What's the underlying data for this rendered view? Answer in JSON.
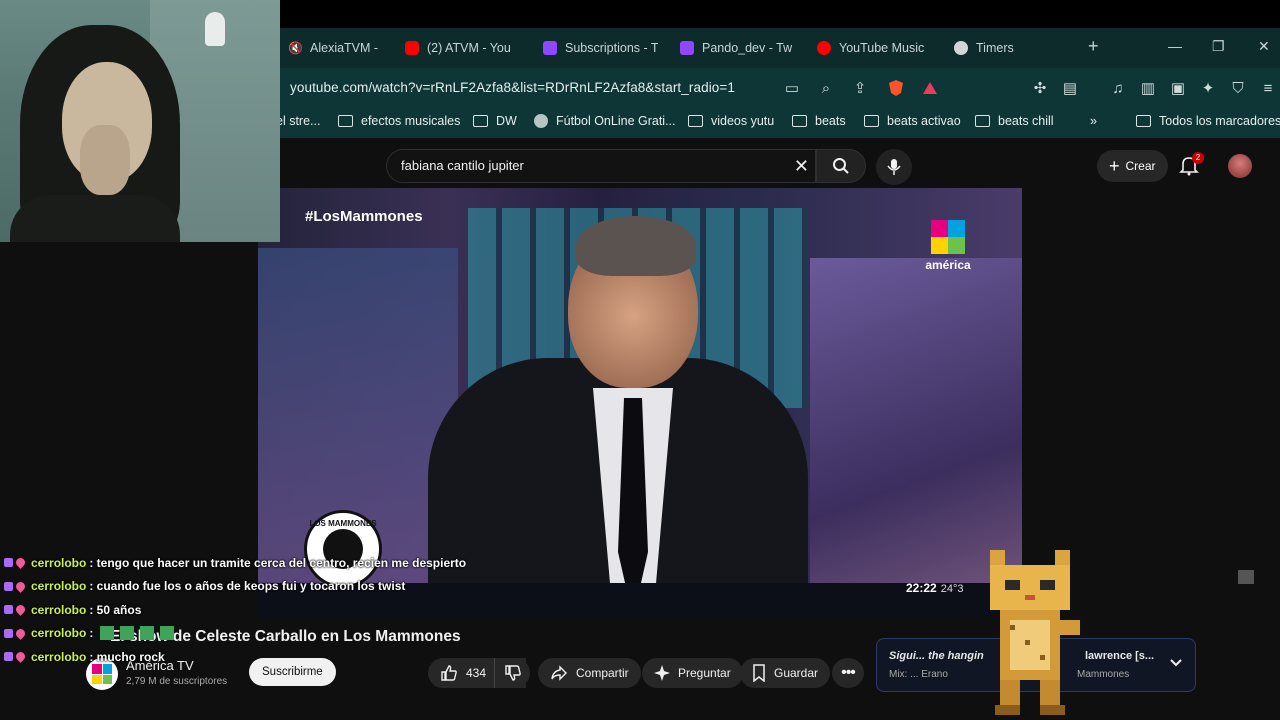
{
  "browser": {
    "tabs": [
      {
        "icon": "muted-speaker-icon",
        "label": "AlexiaTVM -"
      },
      {
        "icon": "youtube-icon",
        "label": "(2) ATVM - You"
      },
      {
        "icon": "twitch-icon",
        "label": "Subscriptions - T"
      },
      {
        "icon": "twitch-icon",
        "label": "Pando_dev - Twi"
      },
      {
        "icon": "youtube-music-icon",
        "label": "YouTube Music"
      },
      {
        "icon": "timer-icon",
        "label": "Timers"
      }
    ],
    "url": "youtube.com/watch?v=rRnLF2Azfa8&list=RDrRnLF2Azfa8&start_radio=1",
    "bookmarks": [
      {
        "icon": "none",
        "label": "el stre..."
      },
      {
        "icon": "folder-icon",
        "label": "efectos musicales"
      },
      {
        "icon": "folder-icon",
        "label": "DW"
      },
      {
        "icon": "globe-icon",
        "label": "Fútbol OnLine Grati..."
      },
      {
        "icon": "folder-icon",
        "label": "videos yutu"
      },
      {
        "icon": "folder-icon",
        "label": "beats"
      },
      {
        "icon": "folder-icon",
        "label": "beats activao"
      },
      {
        "icon": "folder-icon",
        "label": "beats chill"
      },
      {
        "icon": "folder-icon",
        "label": "Todos los marcadores"
      }
    ],
    "bookmarks_more": "»"
  },
  "youtube": {
    "search_query": "fabiana cantilo jupiter",
    "create_label": "Crear",
    "notifications_count": "2",
    "player": {
      "hashtag": "#LosMammones",
      "brand": "américa",
      "clock_time": "22:22",
      "clock_temp": "24°3",
      "mammones_logo_text": "LOS MAMMONES"
    },
    "video_title": "El show de Celeste Carballo en Los Mammones",
    "channel": {
      "name": "América TV",
      "subscribers": "2,79 M de suscriptores",
      "subscribe_label": "Suscribirme"
    },
    "actions": {
      "likes": "434",
      "share": "Compartir",
      "ask": "Preguntar",
      "save": "Guardar"
    },
    "next_card": {
      "line1_left": "Sigui... the hangin",
      "line2_left": "Mix: ... Erano",
      "line1_right": "lawrence [s...",
      "line2_right": "Mammones"
    }
  },
  "chat": [
    {
      "user": "cerrolobo",
      "message": ": tengo que hacer un tramite cerca del centro, recien me despierto"
    },
    {
      "user": "cerrolobo",
      "message": ": cuando fue los o años de keops fui y tocaron los twist"
    },
    {
      "user": "cerrolobo",
      "message": ": 50 años"
    },
    {
      "user": "cerrolobo",
      "message": ":"
    },
    {
      "user": "cerrolobo",
      "message": ": mucho rock"
    }
  ],
  "colors": {
    "chrome_bg": "#0d2b2b",
    "chat_username": "#c8f24a",
    "youtube_red": "#ff0000",
    "twitch_purple": "#9146ff"
  }
}
